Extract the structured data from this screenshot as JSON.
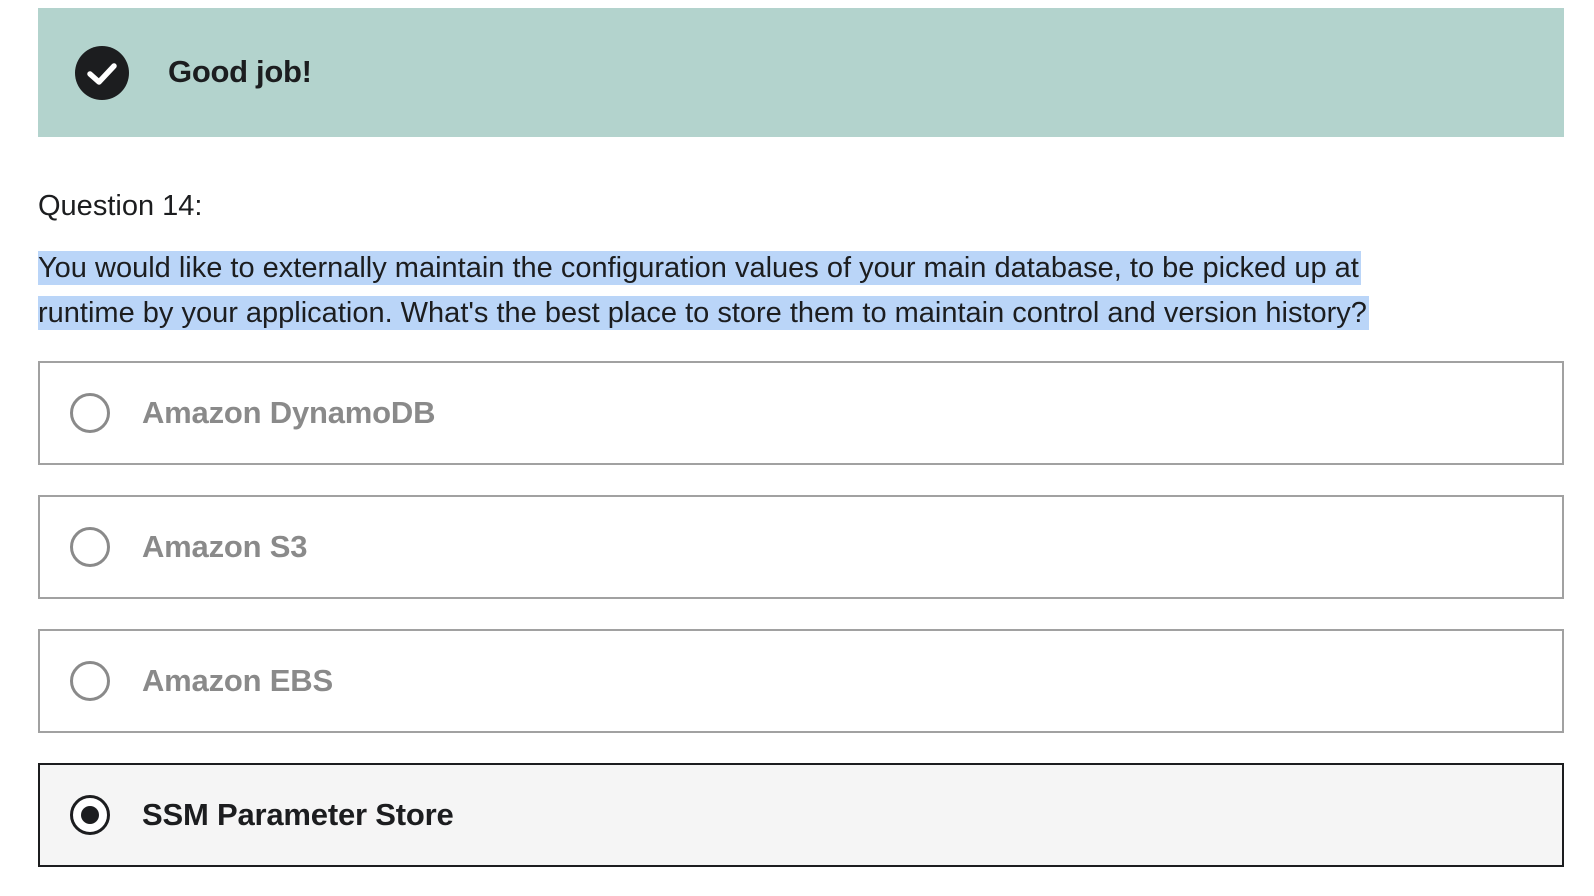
{
  "banner": {
    "icon": "check-circle-icon",
    "text": "Good job!",
    "background": "#b3d3cd"
  },
  "question": {
    "number_label": "Question 14:",
    "text_line1": "You would like to externally maintain the configuration values of your main database, to be picked up at",
    "text_line2": "runtime by your application. What's the best place to store them to maintain control and version history?"
  },
  "options": [
    {
      "label": "Amazon DynamoDB",
      "selected": false
    },
    {
      "label": "Amazon S3",
      "selected": false
    },
    {
      "label": "Amazon EBS",
      "selected": false
    },
    {
      "label": "SSM Parameter Store",
      "selected": true
    }
  ],
  "colors": {
    "selection_highlight": "#bad5f8",
    "text": "#1c1d1f",
    "muted": "#8a8a8a"
  }
}
